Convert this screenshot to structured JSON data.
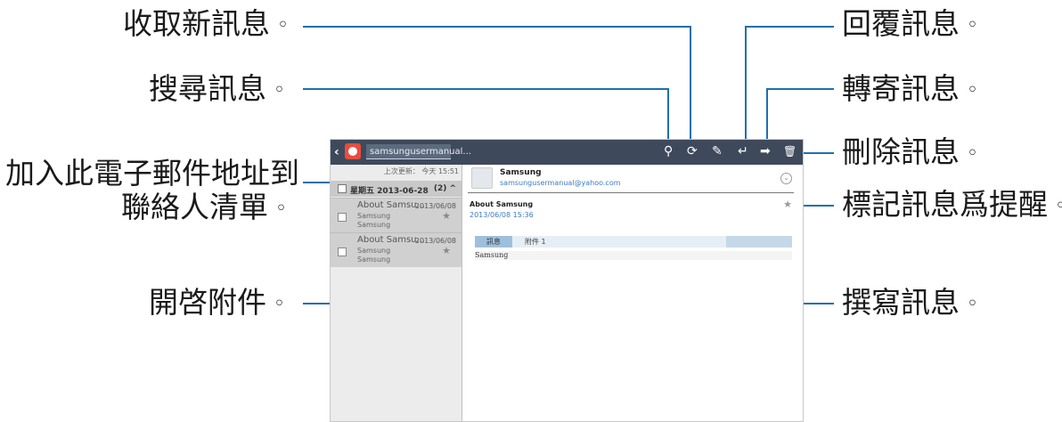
{
  "callouts": {
    "fetch": "收取新訊息",
    "search": "搜尋訊息",
    "add_contact_1": "加入此電子郵件地址到",
    "add_contact_2": "聯絡人清單",
    "open_attachment": "開啓附件",
    "reply": "回覆訊息",
    "forward": "轉寄訊息",
    "delete": "刪除訊息",
    "mark_reminder": "標記訊息爲提醒",
    "compose": "撰寫訊息",
    "dot": "◦"
  },
  "toolbar": {
    "back_icon": "chevron-left-icon",
    "app_icon": "email-app-icon",
    "account": "samsungusermanual...",
    "search_icon": "⚲",
    "refresh_icon": "⟳",
    "compose_icon": "✎",
    "reply_icon": "↵",
    "forward_icon": "➡",
    "delete_icon": "🗑"
  },
  "list": {
    "last_updated": "上次更新： 今天 15:51",
    "group": {
      "label": "星期五  2013-06-28",
      "count": "(2) ^"
    },
    "items": [
      {
        "subject": "About Samsu...",
        "date": "2013/06/08",
        "line1": "Samsung",
        "line2": "Samsung"
      },
      {
        "subject": "About Samsu...",
        "date": "2013/06/08",
        "line1": "Samsung",
        "line2": "Samsung"
      }
    ]
  },
  "message": {
    "sender_name": "Samsung",
    "sender_email": "samsungusermanual@yahoo.com",
    "subject": "About Samsung",
    "datetime": "2013/06/08  15:36",
    "tab_message": "訊息",
    "tab_attachment": "附件 1",
    "body": "Samsung"
  }
}
